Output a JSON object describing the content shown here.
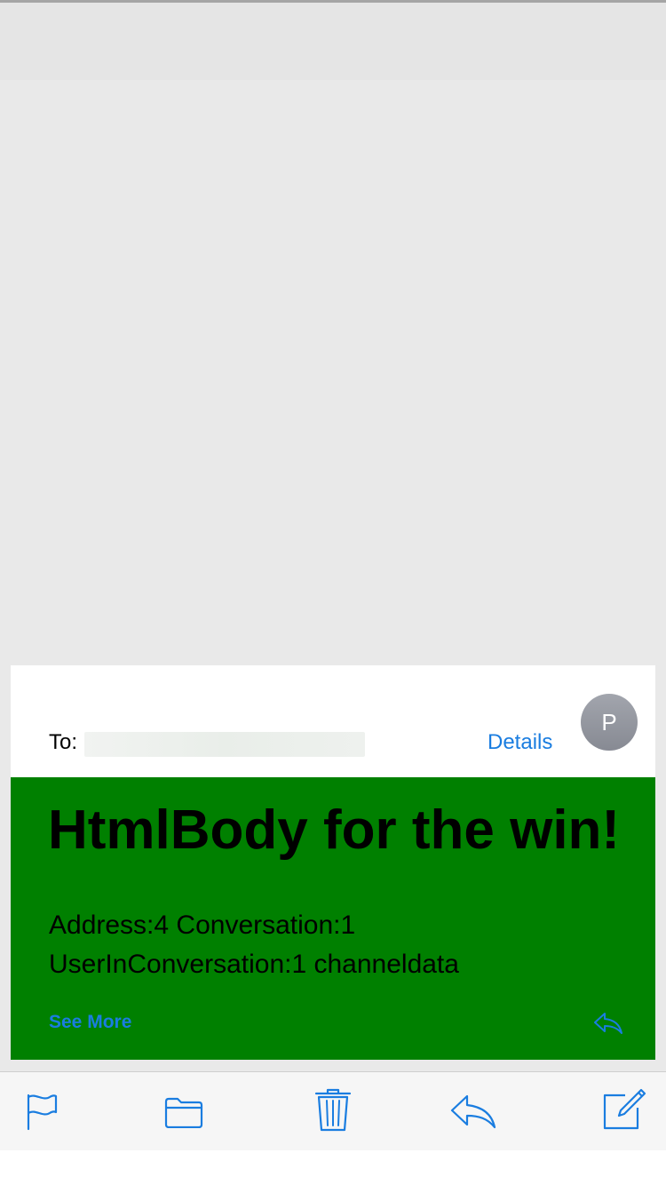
{
  "header": {
    "to_label": "To:",
    "details_label": "Details",
    "avatar_initial": "P"
  },
  "message": {
    "heading": "HtmlBody for the win!",
    "body": "Address:4 Conversation:1 UserInConversation:1 channeldata",
    "see_more_label": "See More"
  },
  "colors": {
    "accent": "#1a7de0",
    "body_background": "#008000",
    "avatar": "#8d9099"
  },
  "toolbar": {
    "icons": [
      "flag-icon",
      "folder-icon",
      "trash-icon",
      "reply-icon",
      "compose-icon"
    ]
  }
}
